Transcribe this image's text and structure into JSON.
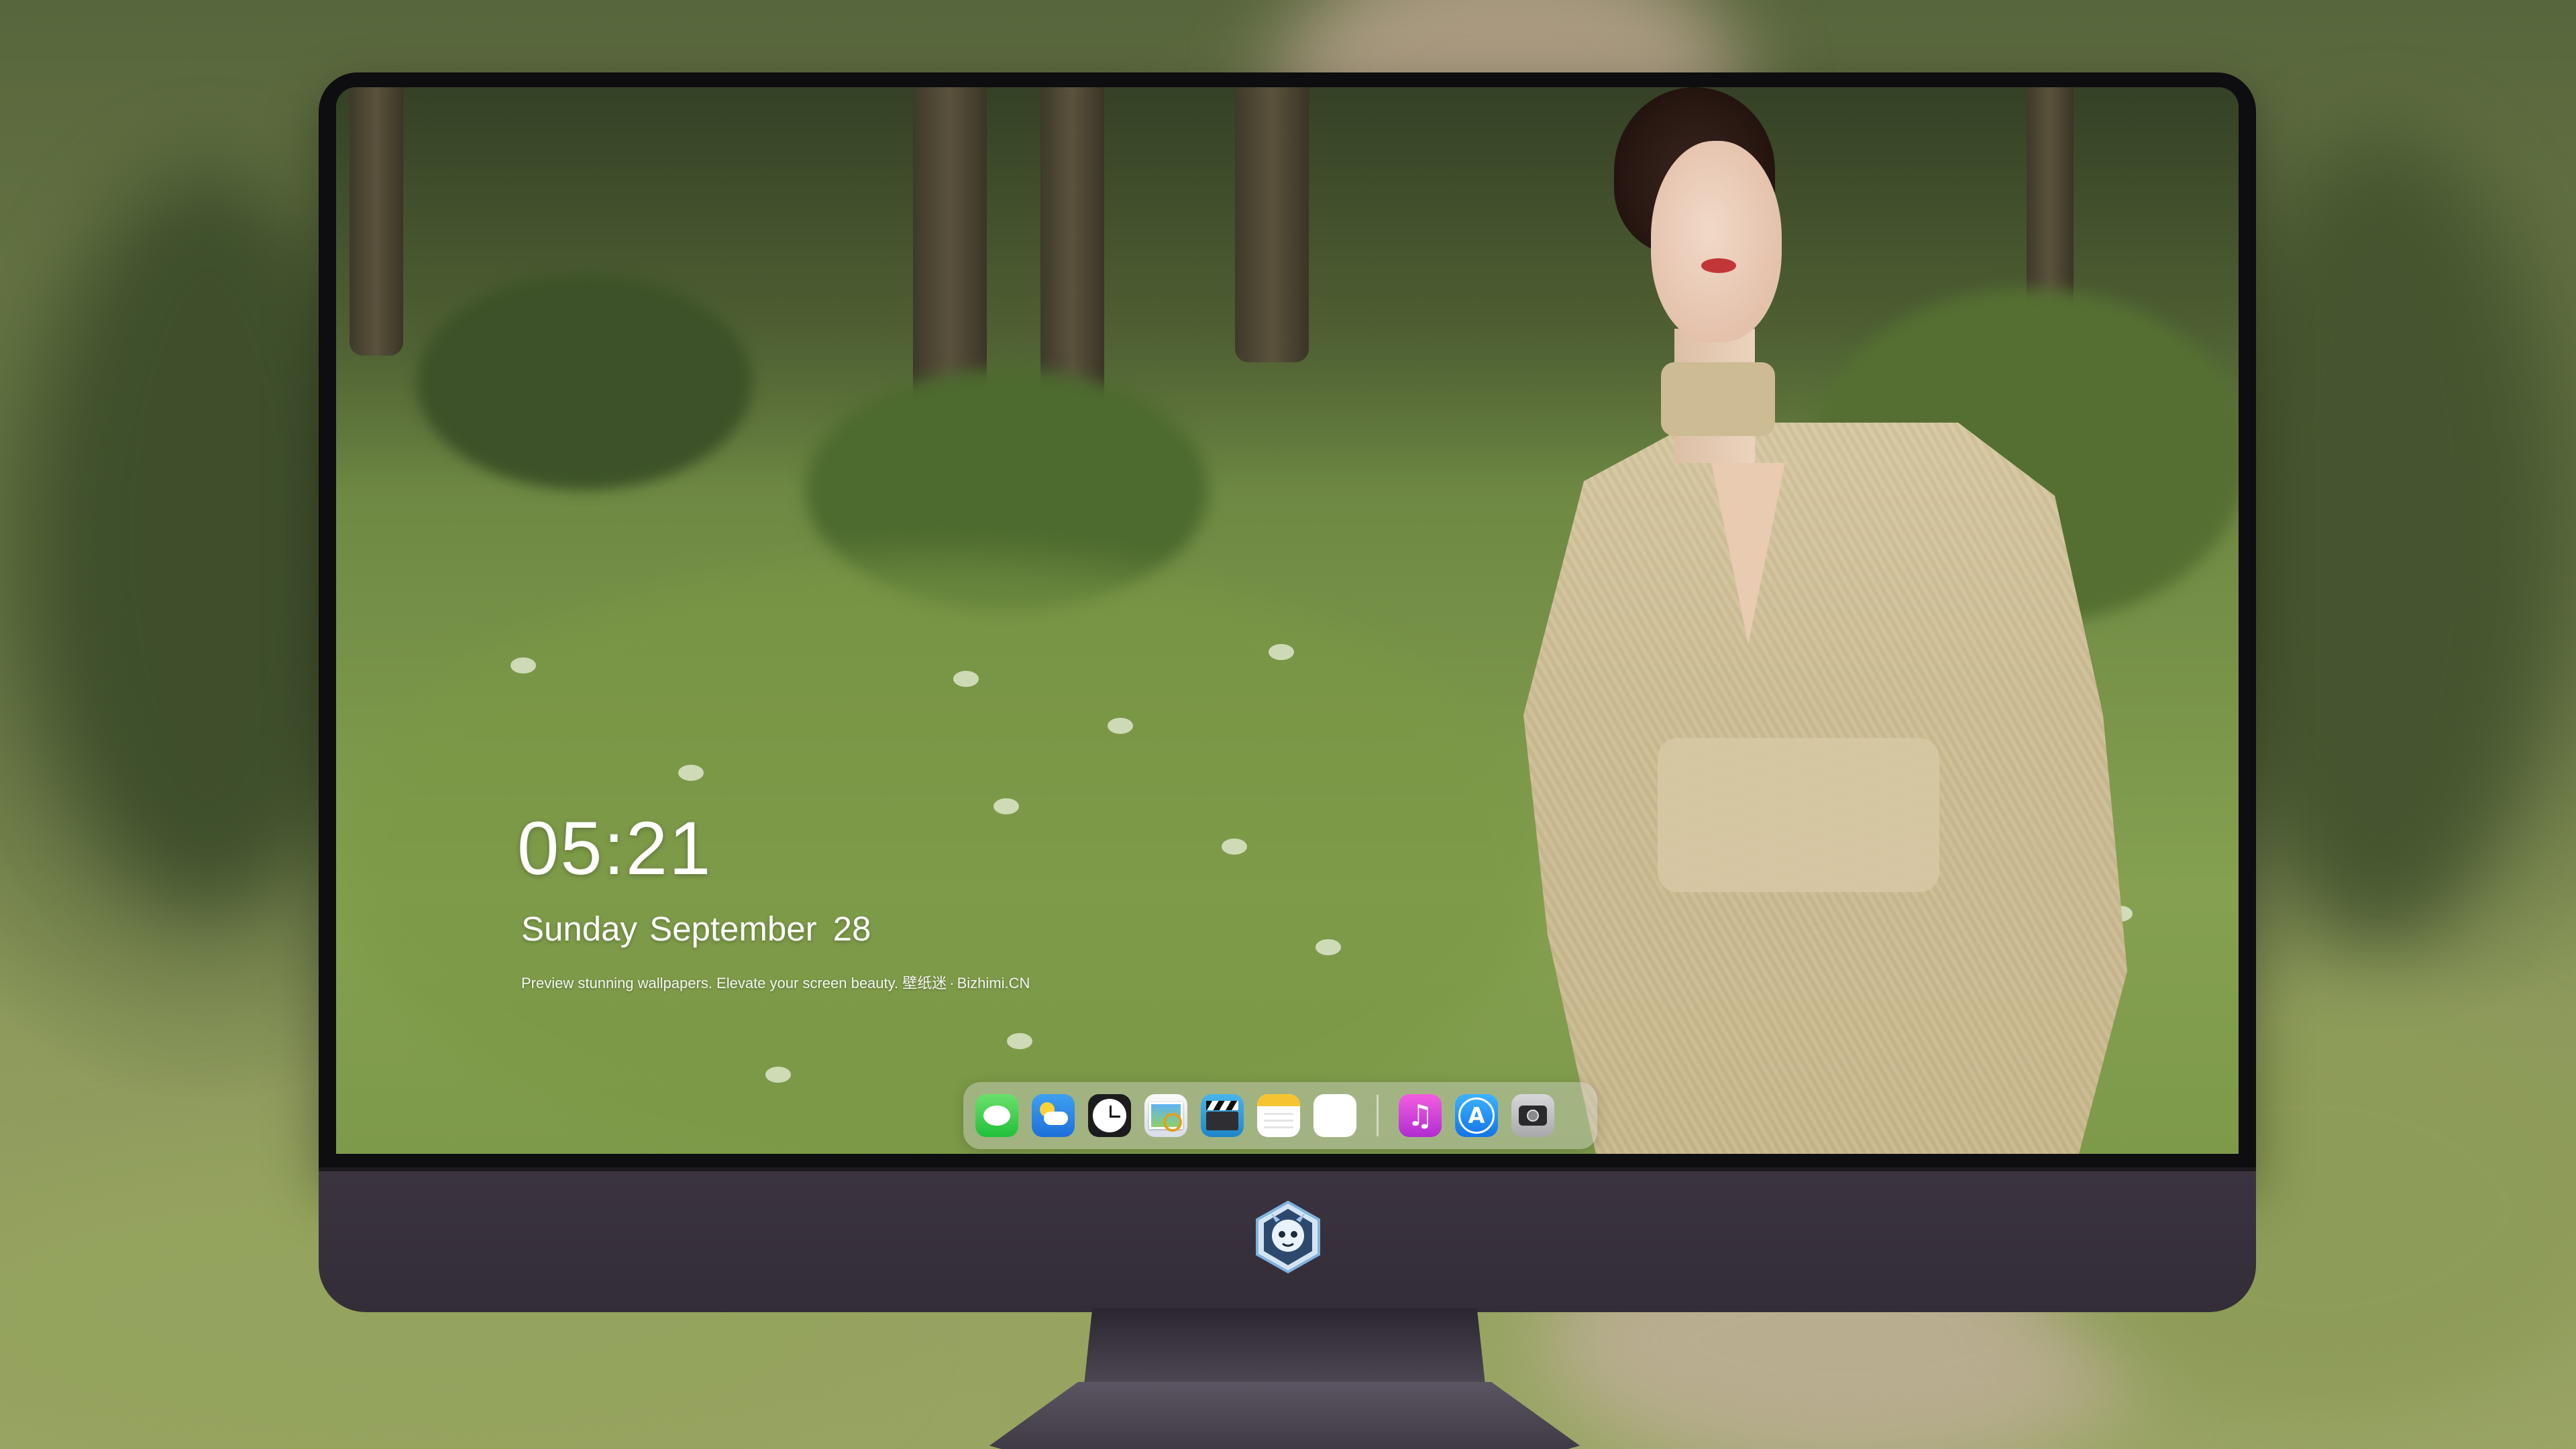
{
  "lock_screen": {
    "time": "05:21",
    "date_text": "Sunday September",
    "date_day": "28",
    "tagline_text": "Preview stunning wallpapers. Elevate your screen beauty.",
    "tagline_brand_cn": "壁纸迷",
    "tagline_separator": "·",
    "tagline_brand_en": "Bizhimi.CN"
  },
  "dock": {
    "apps": [
      {
        "icon": "messages-icon"
      },
      {
        "icon": "weather-icon"
      },
      {
        "icon": "clock-icon"
      },
      {
        "icon": "preview-icon"
      },
      {
        "icon": "clapperboard-icon"
      },
      {
        "icon": "notes-icon"
      },
      {
        "icon": "photos-grid-icon"
      },
      {
        "icon": "music-icon"
      },
      {
        "icon": "app-store-icon"
      },
      {
        "icon": "camera-icon"
      }
    ]
  },
  "monitor": {
    "chin_logo": "dragon-mascot-logo"
  },
  "colors": {
    "bezel": "#0e0d10",
    "chin": "#3b3440",
    "dock_background": "rgba(215,215,210,0.42)"
  }
}
